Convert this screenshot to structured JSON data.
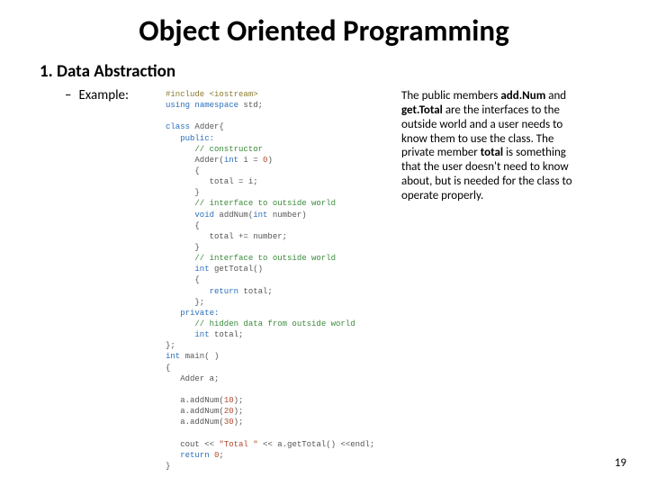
{
  "title": "Object Oriented Programming",
  "subtitle": "1. Data Abstraction",
  "bullet": {
    "dash": "–",
    "label": "Example:"
  },
  "code": {
    "l1a": "#include",
    "l1b": " <iostream>",
    "l2a": "using",
    "l2b": " namespace",
    "l2c": " std;",
    "l3a": "class",
    "l3b": " Adder{",
    "l4": "public:",
    "l5": "// constructor",
    "l6a": "      Adder(",
    "l6b": "int",
    "l6c": " i = ",
    "l6d": "0",
    "l6e": ")",
    "l7": "{",
    "l8": "total = i;",
    "l9": "}",
    "l10": "// interface to outside world",
    "l11a": "void",
    "l11b": " addNum(",
    "l11c": "int",
    "l11d": " number)",
    "l12": "{",
    "l13": "total += number;",
    "l14": "}",
    "l15": "// interface to outside world",
    "l16a": "int",
    "l16b": " getTotal()",
    "l17": "{",
    "l18a": "return",
    "l18b": " total;",
    "l19": "};",
    "l20": "private:",
    "l21": "// hidden data from outside world",
    "l22a": "int",
    "l22b": " total;",
    "l23": "};",
    "l24a": "int",
    "l24b": " main( )",
    "l25": "{",
    "l26": "Adder a;",
    "l27a": "   a.addNum(",
    "l27b": "10",
    "l27c": ");",
    "l28a": "   a.addNum(",
    "l28b": "20",
    "l28c": ");",
    "l29a": "   a.addNum(",
    "l29b": "30",
    "l29c": ");",
    "l30a": "   cout << ",
    "l30b": "\"Total \"",
    "l30c": " << a.getTotal() <<endl;",
    "l31a": "return",
    "l31b": " ",
    "l31c": "0",
    "l31d": ";",
    "l32": "}"
  },
  "side": {
    "t1": "The public members ",
    "b1": "add.Num",
    "t2": " and ",
    "b2": "get.Total",
    "t3": " are the interfaces to the outside world and a user needs to know them to use the class. The private member ",
    "b3": "total",
    "t4": " is something that the user doesn't need to know about, but is needed for the class to operate properly."
  },
  "page": "19"
}
